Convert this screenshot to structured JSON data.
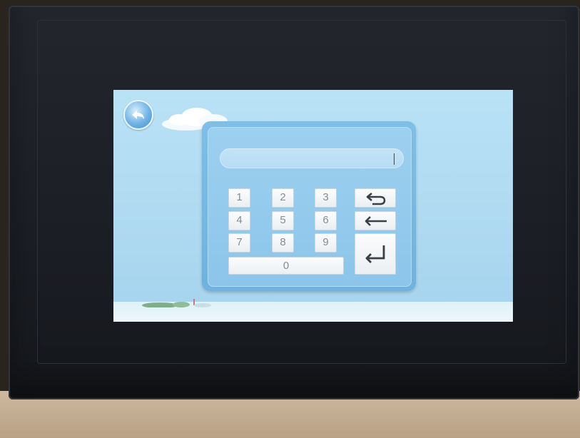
{
  "keypad": {
    "keys": [
      "1",
      "2",
      "3",
      "4",
      "5",
      "6",
      "7",
      "8",
      "9",
      "0"
    ]
  },
  "icons": {
    "back": "circular-back-arrow-icon",
    "cancel": "return-arrow-icon",
    "backspace": "left-arrow-icon",
    "enter": "enter-arrow-icon"
  },
  "colors": {
    "sky": "#b9e2f6",
    "dialog": "#7fbfe7",
    "key": "#f5f7f9",
    "key_text": "#8a8a94"
  }
}
